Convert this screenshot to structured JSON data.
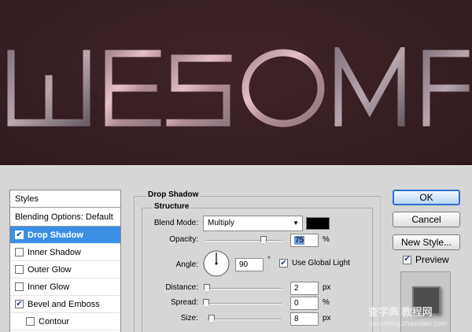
{
  "artwork": {
    "text": "WESOME"
  },
  "styles_panel": {
    "header": "Styles",
    "blending_options": "Blending Options: Default",
    "items": [
      {
        "label": "Drop Shadow",
        "checked": true,
        "selected": true
      },
      {
        "label": "Inner Shadow",
        "checked": false,
        "selected": false
      },
      {
        "label": "Outer Glow",
        "checked": false,
        "selected": false
      },
      {
        "label": "Inner Glow",
        "checked": false,
        "selected": false
      },
      {
        "label": "Bevel and Emboss",
        "checked": true,
        "selected": false
      },
      {
        "label": "Contour",
        "checked": false,
        "selected": false
      }
    ]
  },
  "drop_shadow": {
    "title": "Drop Shadow",
    "structure_title": "Structure",
    "blend_mode_label": "Blend Mode:",
    "blend_mode_value": "Multiply",
    "shadow_color": "#000000",
    "opacity_label": "Opacity:",
    "opacity_value": "75",
    "opacity_unit": "%",
    "angle_label": "Angle:",
    "angle_value": "90",
    "angle_unit": "°",
    "global_light_label": "Use Global Light",
    "global_light_checked": true,
    "distance_label": "Distance:",
    "distance_value": "2",
    "distance_unit": "px",
    "spread_label": "Spread:",
    "spread_value": "0",
    "spread_unit": "%",
    "size_label": "Size:",
    "size_value": "8",
    "size_unit": "px"
  },
  "buttons": {
    "ok": "OK",
    "cancel": "Cancel",
    "new_style": "New Style...",
    "preview_label": "Preview",
    "preview_checked": true
  },
  "watermark": {
    "text": "查字典 教程网",
    "url": "jiaocheng.chazidian.com"
  }
}
